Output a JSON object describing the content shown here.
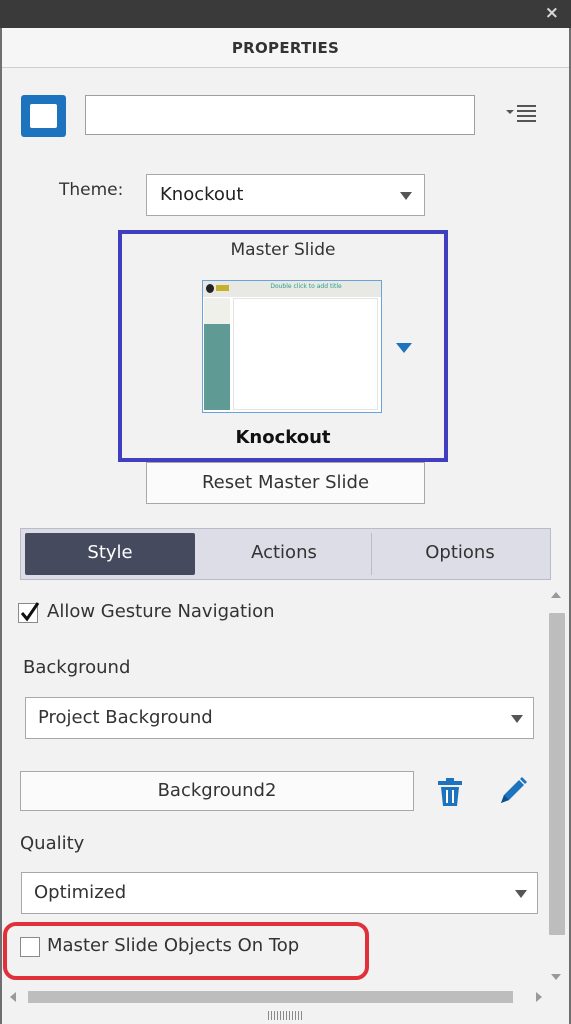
{
  "window": {
    "close_glyph": "×"
  },
  "panel": {
    "title": "PROPERTIES"
  },
  "object": {
    "name_value": "",
    "name_placeholder": "",
    "shape_icon": "rectangle-shape-icon",
    "menu_icon": "panel-menu-icon"
  },
  "theme": {
    "label": "Theme:",
    "selected": "Knockout"
  },
  "master_slide": {
    "label": "Master Slide",
    "thumbnail_title": "Double click to add title",
    "name": "Knockout",
    "reset_label": "Reset Master Slide"
  },
  "tabs": [
    {
      "label": "Style",
      "active": true
    },
    {
      "label": "Actions",
      "active": false
    },
    {
      "label": "Options",
      "active": false
    }
  ],
  "style": {
    "allow_gesture_navigation": {
      "label": "Allow Gesture Navigation",
      "checked": true
    },
    "background": {
      "label": "Background",
      "selected": "Project Background"
    },
    "background_image": {
      "name": "Background2",
      "delete_icon": "trash-icon",
      "edit_icon": "pencil-icon"
    },
    "quality": {
      "label": "Quality",
      "selected": "Optimized"
    },
    "master_objects_on_top": {
      "label": "Master Slide Objects On Top",
      "checked": false
    }
  },
  "colors": {
    "accent_blue": "#1e73be",
    "highlight_blue": "#3f3fbf",
    "highlight_red": "#e0303a",
    "active_tab": "#454a5e",
    "titlebar": "#3a3a3a"
  }
}
